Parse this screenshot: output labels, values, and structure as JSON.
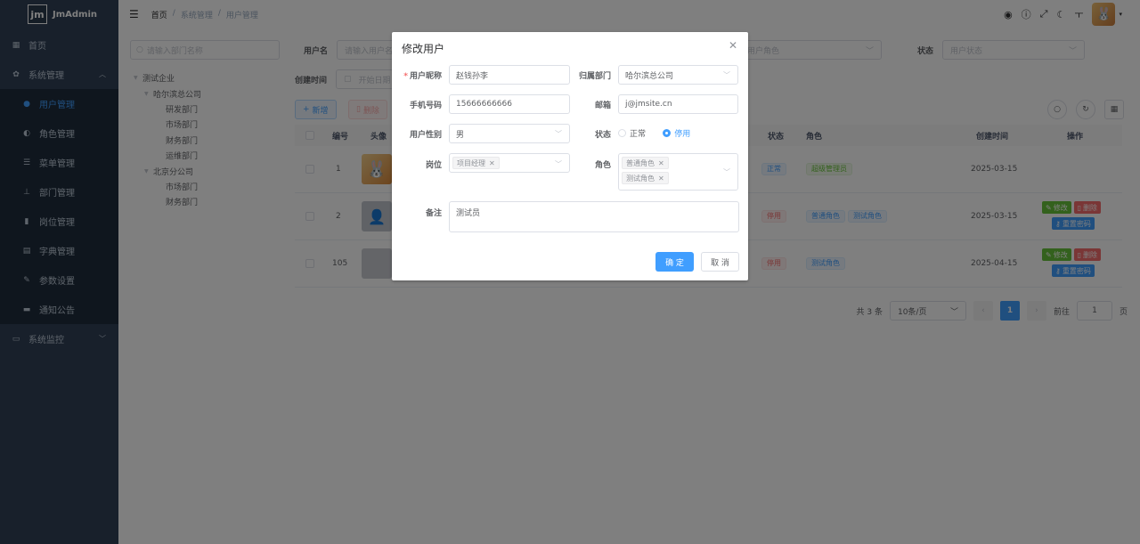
{
  "app": {
    "logo_mark": "jm",
    "name": "JmAdmin"
  },
  "sidebar": {
    "home": "首页",
    "system": "系统管理",
    "items": [
      "用户管理",
      "角色管理",
      "菜单管理",
      "部门管理",
      "岗位管理",
      "字典管理",
      "参数设置",
      "通知公告"
    ],
    "monitor": "系统监控"
  },
  "breadcrumb": [
    "首页",
    "系统管理",
    "用户管理"
  ],
  "tree": {
    "placeholder": "请输入部门名称",
    "nodes": [
      "测试企业",
      "哈尔滨总公司",
      "研发部门",
      "市场部门",
      "财务部门",
      "运维部门",
      "北京分公司",
      "市场部门",
      "财务部门"
    ]
  },
  "search": {
    "username_label": "用户名",
    "username_placeholder": "请输入用户名",
    "role_placeholder": "用户角色",
    "status_label": "状态",
    "status_placeholder": "用户状态",
    "created_label": "创建时间",
    "date_placeholder": "开始日期"
  },
  "toolbar": {
    "add": "新增",
    "delete": "删除"
  },
  "table": {
    "headers": {
      "no": "编号",
      "avatar": "头像",
      "status": "状态",
      "role": "角色",
      "created": "创建时间",
      "actions": "操作"
    },
    "rows": [
      {
        "no": "1",
        "status": "正常",
        "roles": [
          "超级管理员"
        ],
        "created": "2025-03-15"
      },
      {
        "no": "2",
        "status": "停用",
        "roles": [
          "普通角色",
          "测试角色"
        ],
        "created": "2025-03-15"
      },
      {
        "no": "105",
        "status": "停用",
        "roles": [
          "测试角色"
        ],
        "created": "2025-04-15"
      }
    ],
    "edit": "修改",
    "remove": "删除",
    "reset": "重置密码"
  },
  "pager": {
    "total": "共 3 条",
    "size": "10条/页",
    "page": "1",
    "goto": "前往",
    "goto_value": "1",
    "unit": "页"
  },
  "dialog": {
    "title": "修改用户",
    "nickname_label": "用户昵称",
    "nickname": "赵钱孙李",
    "dept_label": "归属部门",
    "dept": "哈尔滨总公司",
    "phone_label": "手机号码",
    "phone": "15666666666",
    "email_label": "邮箱",
    "email": "j@jmsite.cn",
    "gender_label": "用户性别",
    "gender": "男",
    "status_label": "状态",
    "status_normal": "正常",
    "status_disabled": "停用",
    "post_label": "岗位",
    "posts": [
      "项目经理"
    ],
    "role_label": "角色",
    "roles": [
      "普通角色",
      "测试角色"
    ],
    "remark_label": "备注",
    "remark": "测试员",
    "ok": "确 定",
    "cancel": "取 消"
  }
}
